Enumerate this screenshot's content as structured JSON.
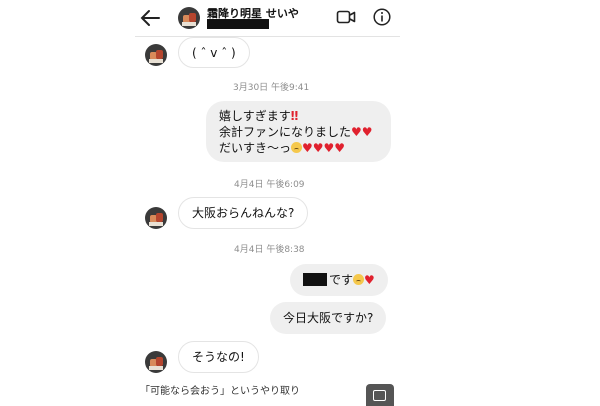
{
  "header": {
    "contact_name": "霜降り明星 せいや",
    "back_icon": "arrow-left-icon",
    "video_icon": "video-call-icon",
    "info_icon": "info-icon"
  },
  "messages": {
    "m1": "( ˆ v ˆ )",
    "ts1": "3月30日 午後9:41",
    "m2_line1": "嬉しすぎます",
    "m2_line2": "余計ファンになりました",
    "m2_line3": "だいすき〜っ",
    "ts2": "4月4日 午後6:09",
    "m3": "大阪おらんねんな?",
    "ts3": "4月4日 午後8:38",
    "m4_suffix": "です",
    "m5": "今日大阪ですか?",
    "m6": "そうなの!"
  },
  "caption": "「可能なら会おう」というやり取り",
  "colors": {
    "heart": "#e0212e",
    "outgoing_bubble": "#efefef",
    "timestamp": "#8e8e8e"
  }
}
